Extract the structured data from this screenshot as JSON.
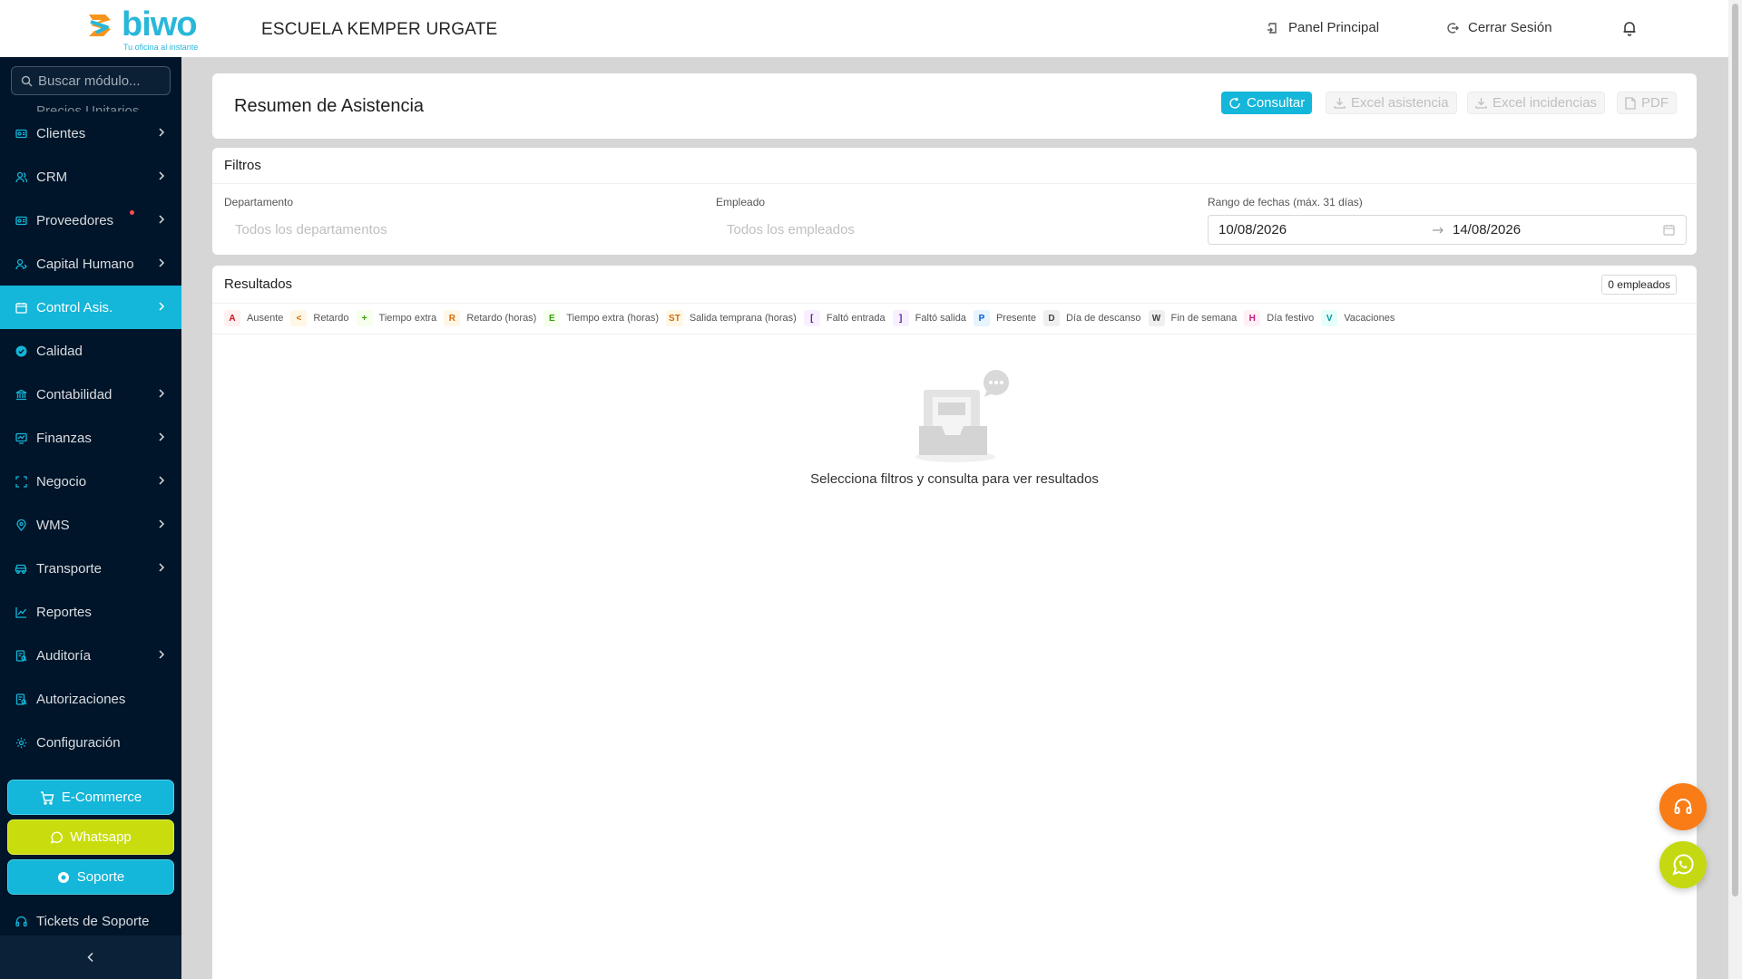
{
  "app": {
    "logo_text": "biwo",
    "logo_tagline": "Tu oficina al instante",
    "company_name": "ESCUELA KEMPER URGATE"
  },
  "top_nav": {
    "panel_principal": "Panel Principal",
    "cerrar_sesion": "Cerrar Sesión"
  },
  "sidebar": {
    "search_placeholder": "Buscar módulo...",
    "partial_item": "Precios Unitarios",
    "items": [
      {
        "label": "Clientes",
        "icon": "id-card-icon",
        "has_chevron": true
      },
      {
        "label": "CRM",
        "icon": "users-icon",
        "has_chevron": true
      },
      {
        "label": "Proveedores",
        "icon": "id-card-icon",
        "has_chevron": true,
        "notification_dot": true
      },
      {
        "label": "Capital Humano",
        "icon": "user-group-icon",
        "has_chevron": true
      },
      {
        "label": "Control Asis.",
        "icon": "calendar-icon",
        "has_chevron": true,
        "active": true
      },
      {
        "label": "Calidad",
        "icon": "check-circle-icon",
        "has_chevron": false
      },
      {
        "label": "Contabilidad",
        "icon": "bank-icon",
        "has_chevron": true
      },
      {
        "label": "Finanzas",
        "icon": "fund-icon",
        "has_chevron": true
      },
      {
        "label": "Negocio",
        "icon": "expand-icon",
        "has_chevron": true
      },
      {
        "label": "WMS",
        "icon": "location-icon",
        "has_chevron": true
      },
      {
        "label": "Transporte",
        "icon": "car-icon",
        "has_chevron": true
      },
      {
        "label": "Reportes",
        "icon": "line-chart-icon",
        "has_chevron": false
      },
      {
        "label": "Auditoría",
        "icon": "audit-icon",
        "has_chevron": true
      },
      {
        "label": "Autorizaciones",
        "icon": "audit-icon",
        "has_chevron": false
      },
      {
        "label": "Configuración",
        "icon": "gear-icon",
        "has_chevron": false
      }
    ],
    "ecommerce_label": "E-Commerce",
    "whatsapp_label": "Whatsapp",
    "soporte_label": "Soporte",
    "tickets_label": "Tickets de Soporte"
  },
  "header": {
    "title": "Resumen de Asistencia",
    "consultar": "Consultar",
    "excel_asistencia": "Excel asistencia",
    "excel_incidencias": "Excel incidencias",
    "pdf": "PDF"
  },
  "filters": {
    "title": "Filtros",
    "departamento_label": "Departamento",
    "departamento_placeholder": "Todos los departamentos",
    "empleado_label": "Empleado",
    "empleado_placeholder": "Todos los empleados",
    "rango_label": "Rango de fechas (máx. 31 días)",
    "fecha_inicio": "10/08/2026",
    "fecha_fin": "14/08/2026"
  },
  "results": {
    "title": "Resultados",
    "count": "0 empleados",
    "empty_message": "Selecciona filtros y consulta para ver resultados",
    "legend": [
      {
        "code": "A",
        "label": "Ausente",
        "bg": "#fff1f0",
        "fg": "#cf1322"
      },
      {
        "code": "<",
        "label": "Retardo",
        "bg": "#fff7e6",
        "fg": "#d46b08"
      },
      {
        "code": "+",
        "label": "Tiempo extra",
        "bg": "#f6ffed",
        "fg": "#389e0d"
      },
      {
        "code": "R",
        "label": "Retardo (horas)",
        "bg": "#fff7e6",
        "fg": "#d46b08"
      },
      {
        "code": "E",
        "label": "Tiempo extra (horas)",
        "bg": "#f6ffed",
        "fg": "#389e0d"
      },
      {
        "code": "ST",
        "label": "Salida temprana (horas)",
        "bg": "#fff7e6",
        "fg": "#d46b08"
      },
      {
        "code": "[",
        "label": "Faltó entrada",
        "bg": "#f9f0ff",
        "fg": "#531dab"
      },
      {
        "code": "]",
        "label": "Faltó salida",
        "bg": "#f9f0ff",
        "fg": "#531dab"
      },
      {
        "code": "P",
        "label": "Presente",
        "bg": "#e6f4ff",
        "fg": "#0958d9"
      },
      {
        "code": "D",
        "label": "Día de descanso",
        "bg": "#f0f0f0",
        "fg": "#434343"
      },
      {
        "code": "W",
        "label": "Fin de semana",
        "bg": "#f0f0f0",
        "fg": "#434343"
      },
      {
        "code": "H",
        "label": "Día festivo",
        "bg": "#fff0f6",
        "fg": "#c41d7f"
      },
      {
        "code": "V",
        "label": "Vacaciones",
        "bg": "#e6fffb",
        "fg": "#08979c"
      }
    ]
  },
  "colors": {
    "accent": "#14b6d9",
    "sidebar_bg": "#001529",
    "lime": "#c9dd0e",
    "orange": "#f97c16"
  }
}
